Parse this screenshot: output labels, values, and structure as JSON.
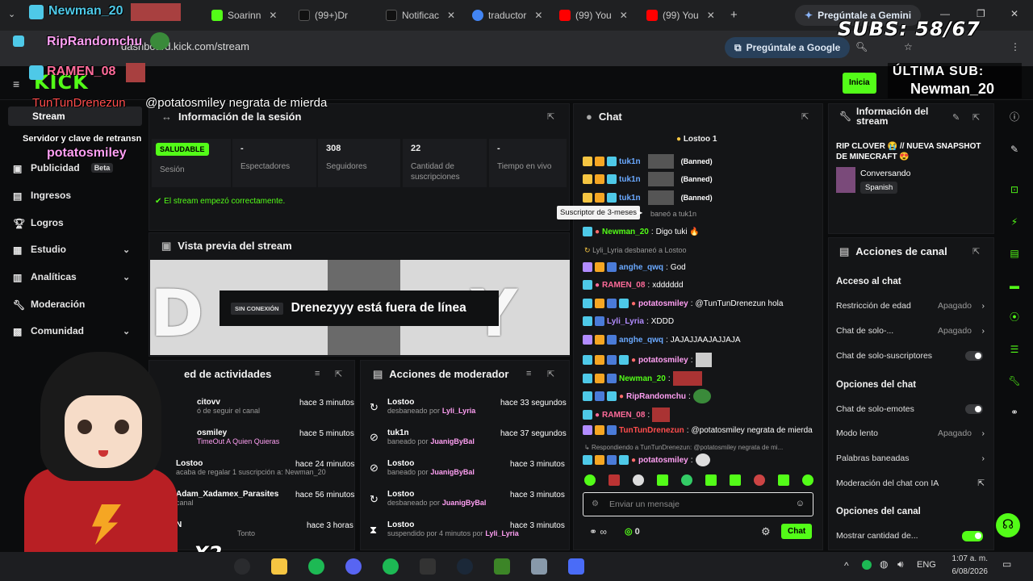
{
  "browser": {
    "tabs": [
      {
        "label": "Soarinn",
        "color": "#53fc18"
      },
      {
        "label": "(99+)Dr",
        "color": "#111111"
      },
      {
        "label": "Notificac",
        "color": "#111111"
      },
      {
        "label": "traductor",
        "color": "#4285f4"
      },
      {
        "label": "(99) You",
        "color": "#ff0000"
      },
      {
        "label": "(99) You",
        "color": "#ff0000"
      }
    ],
    "gemini_tab": "Pregúntale a Gemini",
    "url": "dashboard.kick.com/stream",
    "gemini_button": "Pregúntale a Google"
  },
  "overlay": {
    "subs_label": "SUBS: 58/67",
    "last_sub_label": "ÚLTIMA SUB:",
    "last_sub_name": "Newman_20",
    "chat_names": [
      "Newman_20",
      "RipRandomchu",
      "RAMEN_08"
    ],
    "overlay_msg_user": "TunTunDrenezun",
    "overlay_msg_text": "@potatosmiley negrata de mierda",
    "overlay_server": "Servidor y clave de retransn",
    "overlay_potato": "potatosmiley",
    "multiplier": "X2"
  },
  "kick": {
    "logo": "KICK",
    "start_button": "Inicia"
  },
  "sidebar": {
    "items": [
      {
        "label": "Stream"
      },
      {
        "label": "Publicidad",
        "badge": "Beta"
      },
      {
        "label": "Ingresos"
      },
      {
        "label": "Logros"
      },
      {
        "label": "Estudio"
      },
      {
        "label": "Analíticas"
      },
      {
        "label": "Moderación"
      },
      {
        "label": "Comunidad"
      }
    ]
  },
  "session": {
    "title": "Información de la sesión",
    "status_badge": "SALUDABLE",
    "stats": [
      {
        "value": "",
        "label": "Sesión"
      },
      {
        "value": "-",
        "label": "Espectadores"
      },
      {
        "value": "308",
        "label": "Seguidores"
      },
      {
        "value": "22",
        "label": "Cantidad de suscripciones"
      },
      {
        "value": "-",
        "label": "Tiempo en vivo"
      }
    ],
    "started_msg": "El stream empezó correctamente."
  },
  "preview": {
    "title": "Vista previa del stream",
    "offline_badge": "SIN CONEXIÓN",
    "offline_text": "Drenezyyy está fuera de línea"
  },
  "activity": {
    "title": "ed de actividades",
    "items": [
      {
        "user": "citovv",
        "desc": "ó de seguir el canal",
        "time": "hace 3 minutos"
      },
      {
        "user": "osmiley",
        "desc": "TimeOut A Quien Quieras",
        "time": "hace 5 minutos"
      },
      {
        "user": "Lostoo",
        "desc": "acaba de regalar 1 suscripción a: Newman_20",
        "time": "hace 24 minutos"
      },
      {
        "user": "Adam_Xadamex_Parasites",
        "desc": "canal",
        "time": "hace 56 minutos"
      },
      {
        "user": "N",
        "desc": "Tonto",
        "time": "hace 3 horas"
      }
    ]
  },
  "modactions": {
    "title": "Acciones de moderador",
    "items": [
      {
        "user": "Lostoo",
        "action": "desbaneado por",
        "by": "Lyli_Lyria",
        "time": "hace 33 segundos"
      },
      {
        "user": "tuk1n",
        "action": "baneado por",
        "by": "JuanigByBal",
        "time": "hace 37 segundos"
      },
      {
        "user": "Lostoo",
        "action": "baneado por",
        "by": "JuanigByBal",
        "time": "hace 3 minutos"
      },
      {
        "user": "Lostoo",
        "action": "desbaneado por",
        "by": "JuanigByBal",
        "time": "hace 3 minutos"
      },
      {
        "user": "Lostoo",
        "action": "suspendido por 4 minutos por",
        "by": "Lyli_Lyria",
        "time": "hace 3 minutos"
      }
    ]
  },
  "chat": {
    "title": "Chat",
    "pinned": "Lostoo 1",
    "tooltip": "Suscriptor de 3-meses",
    "messages": [
      {
        "user": "tuk1n",
        "text": "(Banned)",
        "color": "#6aa9ff"
      },
      {
        "user": "tuk1n",
        "text": "(Banned)",
        "color": "#6aa9ff"
      },
      {
        "user": "tuk1n",
        "text": "(Banned)",
        "color": "#6aa9ff"
      },
      {
        "user": "",
        "text": "baneó a tuk1n",
        "color": "#9a9a9a"
      },
      {
        "user": "Newman_20",
        "text": "Digo tuki 🔥",
        "color": "#53fc18"
      },
      {
        "user": "Lyli_Lyria",
        "text": "desbaneó a Lostoo",
        "color": "#9a9a9a"
      },
      {
        "user": "anghe_qwq",
        "text": "God",
        "color": "#6aa9ff"
      },
      {
        "user": "RAMEN_08",
        "text": "xdddddd",
        "color": "#ff6b9a"
      },
      {
        "user": "potatosmiley",
        "text": "@TunTunDrenezun hola",
        "color": "#ff9ff3"
      },
      {
        "user": "Lyli_Lyria",
        "text": "XDDD",
        "color": "#b28cff"
      },
      {
        "user": "anghe_qwq",
        "text": "JAJAJJAAJAJJAJA",
        "color": "#6aa9ff"
      },
      {
        "user": "potatosmiley",
        "text": "",
        "color": "#ff9ff3"
      },
      {
        "user": "Newman_20",
        "text": "",
        "color": "#53fc18"
      },
      {
        "user": "RipRandomchu",
        "text": "",
        "color": "#ff9ff3"
      },
      {
        "user": "RAMEN_08",
        "text": "",
        "color": "#ff6b9a"
      },
      {
        "user": "TunTunDrenezun",
        "text": "@potatosmiley negrata de mierda",
        "color": "#ff4d4d"
      },
      {
        "user": "",
        "text": "Respondiendo a TunTunDrenezun: @potatosmiley negrata de mi...",
        "color": "#9a9a9a"
      },
      {
        "user": "potatosmiley",
        "text": "",
        "color": "#ff9ff3"
      }
    ],
    "input_placeholder": "Enviar un mensaje",
    "points": "0",
    "send_button": "Chat"
  },
  "streaminfo": {
    "title": "Información del stream",
    "stream_title": "RIP CLOVER 😭 // NUEVA SNAPSHOT DE MINECRAFT 😍",
    "category": "Conversando",
    "language": "Spanish"
  },
  "channelactions": {
    "title": "Acciones de canal",
    "access_header": "Acceso al chat",
    "rows": [
      {
        "label": "Restricción de edad",
        "value": "Apagado"
      },
      {
        "label": "Chat de solo-...",
        "value": "Apagado"
      },
      {
        "label": "Chat de solo-suscriptores",
        "value": ""
      }
    ],
    "chat_options_header": "Opciones del chat",
    "chat_rows": [
      {
        "label": "Chat de solo-emotes",
        "value": ""
      },
      {
        "label": "Modo lento",
        "value": "Apagado"
      },
      {
        "label": "Palabras baneadas",
        "value": ""
      },
      {
        "label": "Moderación del chat con IA",
        "value": ""
      }
    ],
    "channel_options_header": "Opciones del canal",
    "channel_rows": [
      {
        "label": "Mostrar cantidad de...",
        "value": ""
      }
    ]
  },
  "taskbar": {
    "lang": "ENG",
    "time": "1:07 a. m.",
    "date": "6/08/2026"
  }
}
